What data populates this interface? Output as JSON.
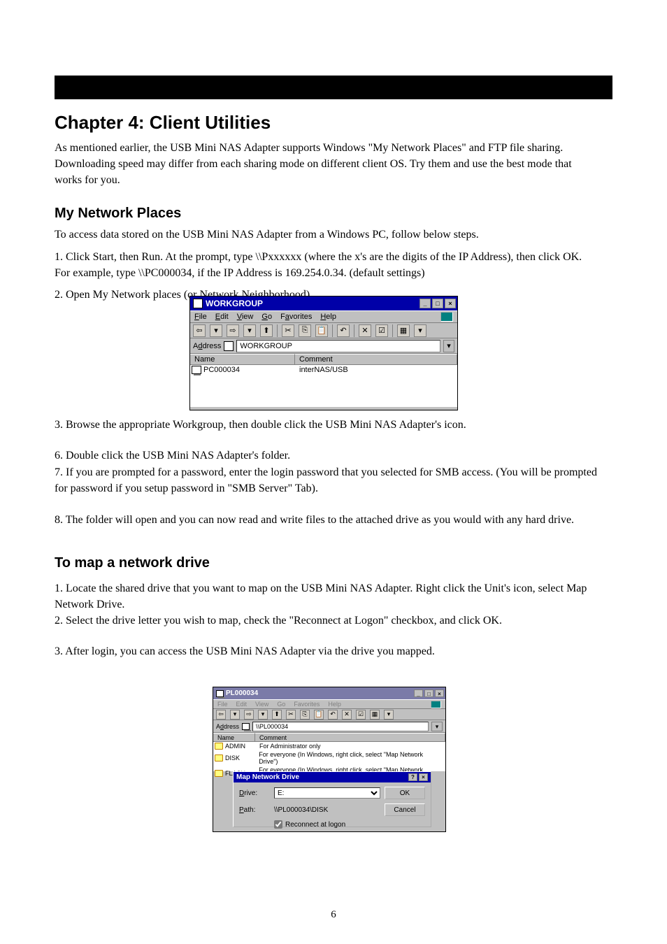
{
  "page": {
    "chapter_title": "Chapter 4: Client Utilities",
    "intro": "As mentioned earlier, the USB Mini NAS Adapter supports Windows \"My Network Places\" and FTP file sharing. Downloading speed may differ from each sharing mode on different client OS. Try them and use the best mode that works for you.",
    "section_my_network": "My Network Places",
    "my_network_intro": "To access data stored on the USB Mini NAS Adapter from a Windows PC, follow below steps.",
    "step1": "1. Click Start, then Run. At the prompt, type \\\\Pxxxxxx (where the x's are the digits of the IP Address), then click OK. For example, type \\\\PC000034, if the IP Address is 169.254.0.34. (default settings)",
    "step2": "2. Open My Network places (or Network Neighborhood).",
    "step3": "3. Browse the appropriate Workgroup, then double click the USB Mini NAS Adapter's icon.",
    "step6": "6. Double click the USB Mini NAS Adapter's folder.",
    "step7": "7. If you are prompted for a password, enter the login password that you selected for SMB access. (You will be prompted for password if you setup password in \"SMB Server\" Tab).",
    "step8": "8. The folder will open and you can now read and write files to the attached drive as you would with any hard drive.",
    "section_map_drive": "To map a network drive",
    "step_map1": "1. Locate the shared drive that you want to map on the USB Mini NAS Adapter. Right click the Unit's icon, select Map Network Drive.",
    "step_map2": "2. Select the drive letter you wish to map, check the \"Reconnect at Logon\" checkbox, and click OK.",
    "step_map3": "3. After login, you can access the USB Mini NAS Adapter via the drive you mapped."
  },
  "shot1": {
    "title": "WORKGROUP",
    "menu": {
      "file": "File",
      "edit": "Edit",
      "view": "View",
      "go": "Go",
      "fav": "Favorites",
      "help": "Help"
    },
    "addr_label": "Address",
    "addr_value": "WORKGROUP",
    "col_name": "Name",
    "col_comment": "Comment",
    "row_name": "PC000034",
    "row_comment": "interNAS/USB"
  },
  "shot2": {
    "title": "PL000034",
    "menu": {
      "file": "File",
      "edit": "Edit",
      "view": "View",
      "go": "Go",
      "fav": "Favorites",
      "help": "Help"
    },
    "addr_label": "Address",
    "addr_value": "\\\\PL000034",
    "col_name": "Name",
    "col_comment": "Comment",
    "rows": [
      {
        "name": "ADMIN",
        "comment": "For Administrator only"
      },
      {
        "name": "DISK",
        "comment": "For everyone (In Windows, right click, select \"Map Network Drive\")"
      },
      {
        "name": "FLASH",
        "comment": "For everyone (In Windows, right click, select \"Map Network Drive\")"
      }
    ],
    "dialog": {
      "title": "Map Network Drive",
      "drive_label": "Drive:",
      "drive_value": "E:",
      "path_label": "Path:",
      "path_value": "\\\\PL000034\\DISK",
      "reconnect": "Reconnect at logon",
      "ok": "OK",
      "cancel": "Cancel"
    }
  },
  "footer": "6"
}
